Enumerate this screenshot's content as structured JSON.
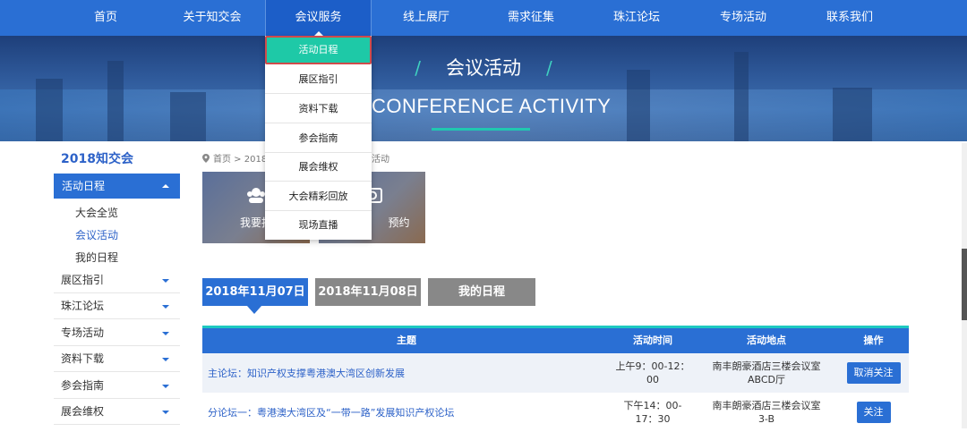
{
  "nav": {
    "items": [
      {
        "label": "首页"
      },
      {
        "label": "关于知交会"
      },
      {
        "label": "会议服务"
      },
      {
        "label": "线上展厅"
      },
      {
        "label": "需求征集"
      },
      {
        "label": "珠江论坛"
      },
      {
        "label": "专场活动"
      },
      {
        "label": "联系我们"
      }
    ],
    "active_index": 2
  },
  "dropdown": {
    "items": [
      {
        "label": "活动日程"
      },
      {
        "label": "展区指引"
      },
      {
        "label": "资料下载"
      },
      {
        "label": "参会指南"
      },
      {
        "label": "展会维权"
      },
      {
        "label": "大会精彩回放"
      },
      {
        "label": "现场直播"
      }
    ],
    "highlighted_index": 0
  },
  "banner": {
    "title": "会议活动",
    "subtitle": "CONFERENCE ACTIVITY"
  },
  "sidebar": {
    "title": "2018知交会",
    "open_section": "活动日程",
    "sub_items": [
      {
        "label": "大会全览"
      },
      {
        "label": "会议活动"
      },
      {
        "label": "我的日程"
      }
    ],
    "selected_sub_index": 1,
    "sections": [
      {
        "label": "展区指引"
      },
      {
        "label": "珠江论坛"
      },
      {
        "label": "专场活动"
      },
      {
        "label": "资料下载"
      },
      {
        "label": "参会指南"
      },
      {
        "label": "展会维权"
      }
    ]
  },
  "breadcrumb": {
    "start": "首页 > 2018",
    "end": "活动"
  },
  "tiles": [
    {
      "label": "我要报"
    },
    {
      "label": "预约"
    }
  ],
  "date_tabs": [
    {
      "label": "2018年11月07日",
      "active": true
    },
    {
      "label": "2018年11月08日",
      "active": false
    },
    {
      "label": "我的日程",
      "active": false
    }
  ],
  "table": {
    "headers": [
      "主题",
      "活动时间",
      "活动地点",
      "操作"
    ],
    "rows": [
      {
        "topic": "主论坛：知识产权支撑粤港澳大湾区创新发展",
        "time_line1": "上午9：00-12：",
        "time_line2": "00",
        "place_line1": "南丰朗豪酒店三楼会议室",
        "place_line2": "ABCD厅",
        "action": "取消关注"
      },
      {
        "topic": "分论坛一：粤港澳大湾区及“一带一路”发展知识产权论坛",
        "time_line1": "下午14：00-",
        "time_line2": "17：30",
        "place_line1": "南丰朗豪酒店三楼会议室",
        "place_line2": "3-B",
        "action": "关注"
      }
    ]
  },
  "colors": {
    "primary": "#2a6fd4",
    "accent": "#1ec9a7",
    "highlight_border": "#d04b4b",
    "tab_inactive": "#888888"
  }
}
